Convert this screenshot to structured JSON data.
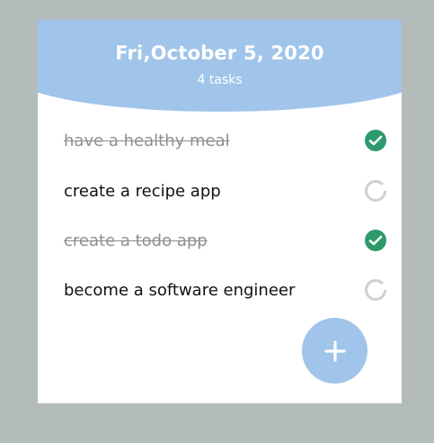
{
  "header": {
    "date": "Fri,October 5, 2020",
    "task_count": "4 tasks"
  },
  "tasks": [
    {
      "label": "have a healthy meal",
      "done": true
    },
    {
      "label": "create a recipe app",
      "done": false
    },
    {
      "label": "create a todo app",
      "done": true
    },
    {
      "label": "become a software engineer",
      "done": false
    }
  ],
  "add_button": {
    "icon": "plus-icon",
    "color": "#a0c4ea"
  },
  "colors": {
    "background": "#b3bbbb",
    "header": "#a0c4ea",
    "check": "#2e9a6c",
    "pending_ring": "#cfcfcf"
  }
}
